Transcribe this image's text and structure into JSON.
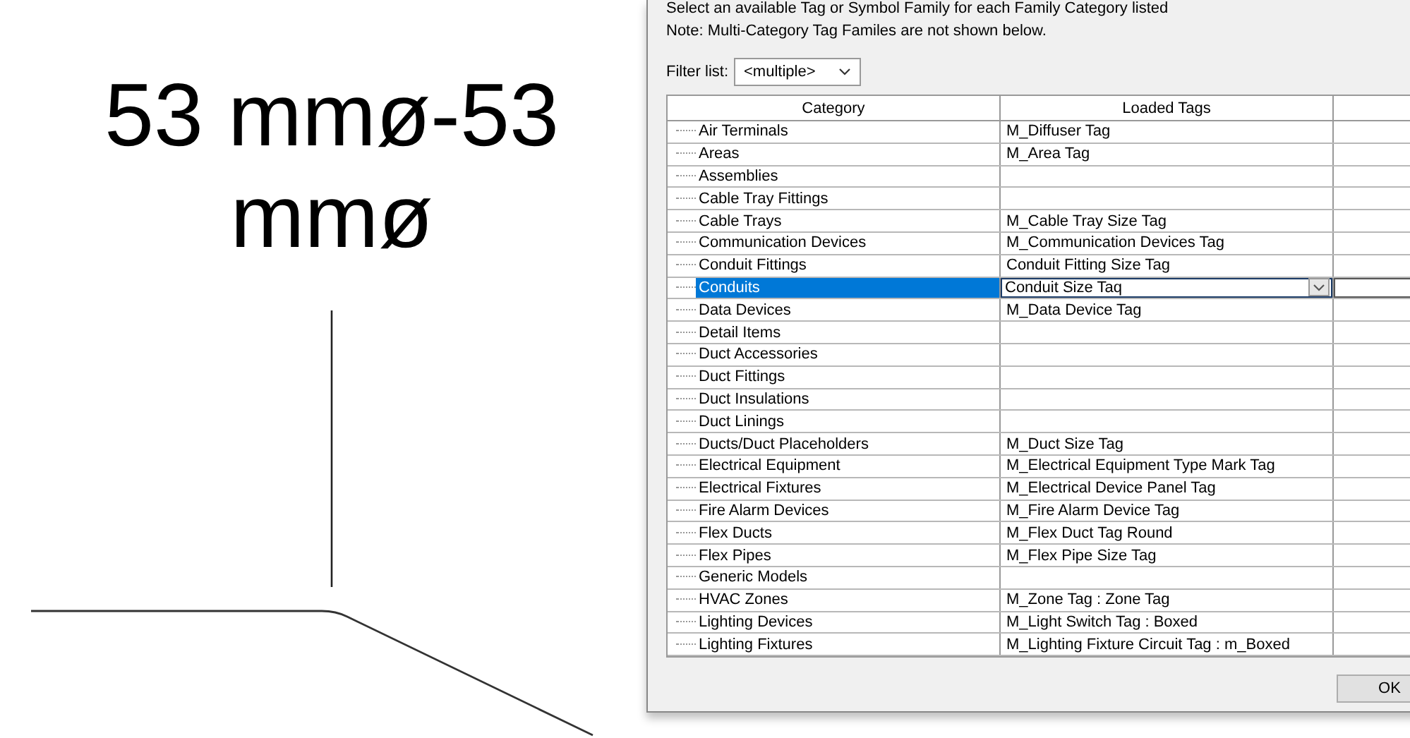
{
  "canvas": {
    "tag_text": "53 mmø-53 mmø"
  },
  "dialog": {
    "instruction": "Select an available Tag or Symbol Family for each Family Category listed",
    "note": "Note: Multi-Category Tag Familes are not shown below.",
    "filter": {
      "label": "Filter list:",
      "value": "<multiple>"
    },
    "table": {
      "columns": [
        "Category",
        "Loaded Tags"
      ],
      "rows": [
        {
          "category": "Air Terminals",
          "loaded_tag": "M_Diffuser Tag",
          "selected": false
        },
        {
          "category": "Areas",
          "loaded_tag": "M_Area Tag",
          "selected": false
        },
        {
          "category": "Assemblies",
          "selected": false
        },
        {
          "category": "Cable Tray Fittings",
          "selected": false
        },
        {
          "category": "Cable Trays",
          "loaded_tag": "M_Cable Tray Size Tag",
          "selected": false
        },
        {
          "category": "Communication Devices",
          "loaded_tag": "M_Communication Devices Tag",
          "selected": false
        },
        {
          "category": "Conduit Fittings",
          "loaded_tag": "Conduit Fitting Size Tag",
          "selected": false
        },
        {
          "category": "Conduits",
          "loaded_tag": "Conduit Size Taq",
          "selected": true
        },
        {
          "category": "Data Devices",
          "loaded_tag": "M_Data Device Tag",
          "selected": false
        },
        {
          "category": "Detail Items",
          "selected": false
        },
        {
          "category": "Duct Accessories",
          "selected": false
        },
        {
          "category": "Duct Fittings",
          "selected": false
        },
        {
          "category": "Duct Insulations",
          "selected": false
        },
        {
          "category": "Duct Linings",
          "selected": false
        },
        {
          "category": "Ducts/Duct Placeholders",
          "loaded_tag": "M_Duct Size Tag",
          "selected": false
        },
        {
          "category": "Electrical Equipment",
          "loaded_tag": "M_Electrical Equipment Type Mark Tag",
          "selected": false
        },
        {
          "category": "Electrical Fixtures",
          "loaded_tag": "M_Electrical Device Panel Tag",
          "selected": false
        },
        {
          "category": "Fire Alarm Devices",
          "loaded_tag": "M_Fire Alarm Device Tag",
          "selected": false
        },
        {
          "category": "Flex Ducts",
          "loaded_tag": "M_Flex Duct Tag Round",
          "selected": false
        },
        {
          "category": "Flex Pipes",
          "loaded_tag": "M_Flex Pipe Size Tag",
          "selected": false
        },
        {
          "category": "Generic Models",
          "selected": false
        },
        {
          "category": "HVAC Zones",
          "loaded_tag": "M_Zone Tag : Zone Tag",
          "selected": false
        },
        {
          "category": "Lighting Devices",
          "loaded_tag": "M_Light Switch Tag : Boxed",
          "selected": false
        },
        {
          "category": "Lighting Fixtures",
          "loaded_tag": "M_Lighting Fixture Circuit Tag : m_Boxed",
          "selected": false
        }
      ]
    },
    "buttons": [
      "OK"
    ]
  }
}
